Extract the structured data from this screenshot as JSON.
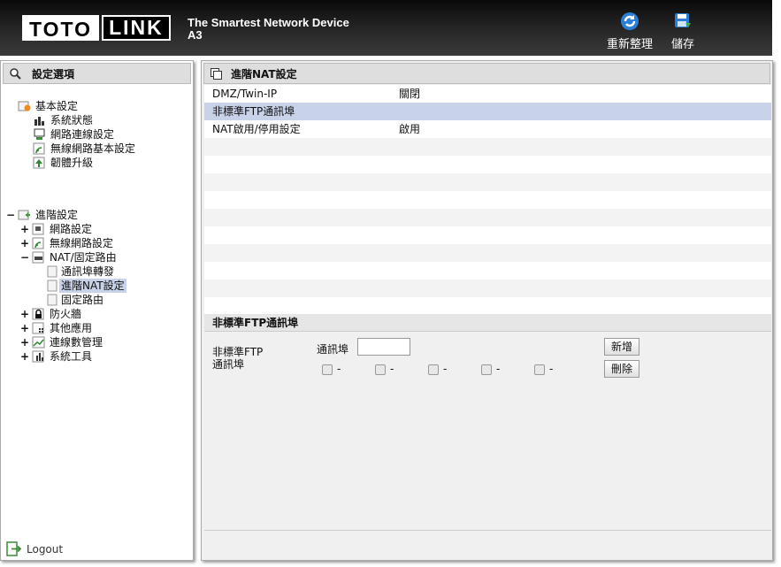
{
  "brand": {
    "logo_left": "TOTO",
    "logo_right": "LINK",
    "tagline1": "The Smartest Network Device",
    "tagline2": "A3"
  },
  "toolbar": {
    "reboot_label": "重新整理",
    "save_label": "儲存"
  },
  "sidebar": {
    "title": "設定選項",
    "basic": {
      "label": "基本設定",
      "items": [
        "系統狀態",
        "網路連線設定",
        "無線網路基本設定",
        "韌體升級"
      ]
    },
    "advanced": {
      "toggle": "−",
      "label": "進階設定",
      "items": [
        {
          "toggle": "+",
          "label": "網路設定"
        },
        {
          "toggle": "+",
          "label": "無線網路設定"
        },
        {
          "toggle": "−",
          "label": "NAT/固定路由",
          "children": [
            "通訊埠轉發",
            "進階NAT設定",
            "固定路由"
          ]
        },
        {
          "toggle": "+",
          "label": "防火牆"
        },
        {
          "toggle": "+",
          "label": "其他應用"
        },
        {
          "toggle": "+",
          "label": "連線數管理"
        },
        {
          "toggle": "+",
          "label": "系統工具"
        }
      ]
    },
    "logout": "Logout"
  },
  "main": {
    "title": "進階NAT設定",
    "rows": [
      {
        "key": "DMZ/Twin-IP",
        "value": "關閉"
      },
      {
        "key": "非標準FTP通訊埠",
        "value": ""
      },
      {
        "key": "NAT啟用/停用設定",
        "value": "啟用"
      }
    ],
    "section_title": "非標準FTP通訊埠",
    "ftp_label_1": "非標準FTP",
    "ftp_label_2": "通訊埠",
    "port_label": "通訊埠",
    "port_value": "",
    "add_label": "新增",
    "delete_label": "刪除",
    "entries": [
      "-",
      "-",
      "-",
      "-",
      "-"
    ]
  },
  "colors": {
    "header_bg": "#1a1a1a",
    "selected_bg": "#c8d2e8",
    "panel_bg": "#f0f0f0"
  }
}
